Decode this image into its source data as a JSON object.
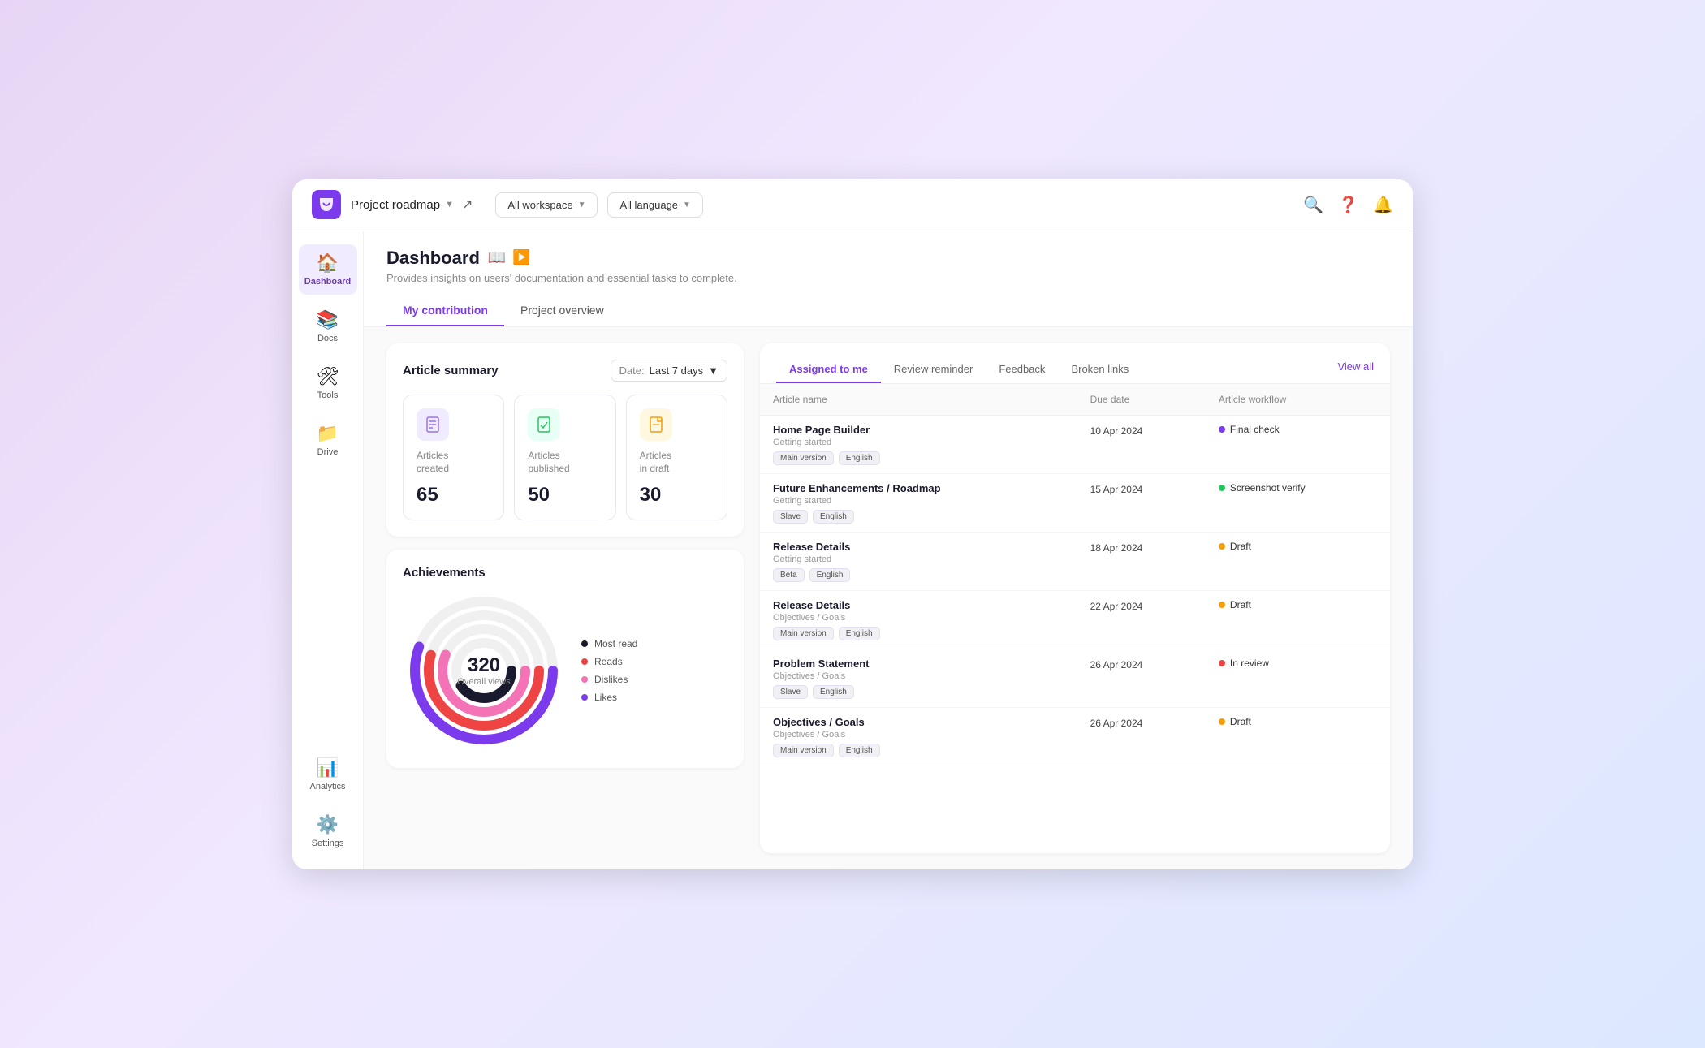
{
  "app": {
    "logo_alt": "Docsie logo",
    "project_name": "Project roadmap",
    "workspace_filter": "All workspace",
    "language_filter": "All language",
    "nav_icons": [
      "search",
      "help",
      "notifications"
    ]
  },
  "sidebar": {
    "items": [
      {
        "id": "dashboard",
        "label": "Dashboard",
        "icon": "🏠",
        "active": true
      },
      {
        "id": "docs",
        "label": "Docs",
        "icon": "📚",
        "active": false
      },
      {
        "id": "tools",
        "label": "Tools",
        "icon": "🛠",
        "active": false
      },
      {
        "id": "drive",
        "label": "Drive",
        "icon": "📁",
        "active": false
      },
      {
        "id": "analytics",
        "label": "Analytics",
        "icon": "📊",
        "active": false
      },
      {
        "id": "settings",
        "label": "Settings",
        "icon": "⚙️",
        "active": false
      }
    ]
  },
  "page": {
    "title": "Dashboard",
    "subtitle": "Provides insights on users' documentation and essential tasks to complete.",
    "tabs": [
      {
        "id": "my-contribution",
        "label": "My contribution",
        "active": true
      },
      {
        "id": "project-overview",
        "label": "Project overview",
        "active": false
      }
    ]
  },
  "article_summary": {
    "title": "Article summary",
    "date_label": "Date:",
    "date_value": "Last 7 days",
    "stats": [
      {
        "id": "created",
        "label": "Articles\ncreated",
        "value": "65",
        "icon": "📄",
        "color": "purple"
      },
      {
        "id": "published",
        "label": "Articles\npublished",
        "value": "50",
        "icon": "📋",
        "color": "green"
      },
      {
        "id": "draft",
        "label": "Articles\nin draft",
        "value": "30",
        "icon": "✏️",
        "color": "yellow"
      }
    ]
  },
  "achievements": {
    "title": "Achievements",
    "total_views": "320",
    "total_label": "Overall views",
    "legend": [
      {
        "id": "most-read",
        "label": "Most read",
        "color": "#1a1a2e"
      },
      {
        "id": "reads",
        "label": "Reads",
        "color": "#ef4444"
      },
      {
        "id": "dislikes",
        "label": "Dislikes",
        "color": "#f472b6"
      },
      {
        "id": "likes",
        "label": "Likes",
        "color": "#7c3aed"
      }
    ],
    "chart": {
      "rings": [
        {
          "color": "#7c3aed",
          "radius": 85,
          "stroke": 12,
          "dasharray": "400 135",
          "rotation": -90
        },
        {
          "color": "#ef4444",
          "radius": 68,
          "stroke": 12,
          "dasharray": "320 107",
          "rotation": -90
        },
        {
          "color": "#f472b6",
          "radius": 51,
          "stroke": 12,
          "dasharray": "260 80",
          "rotation": -90
        },
        {
          "color": "#1a1a2e",
          "radius": 34,
          "stroke": 12,
          "dasharray": "200 14",
          "rotation": -90
        }
      ]
    }
  },
  "panel": {
    "tabs": [
      {
        "id": "assigned-to-me",
        "label": "Assigned to me",
        "active": true
      },
      {
        "id": "review-reminder",
        "label": "Review reminder",
        "active": false
      },
      {
        "id": "feedback",
        "label": "Feedback",
        "active": false
      },
      {
        "id": "broken-links",
        "label": "Broken links",
        "active": false
      }
    ],
    "view_all": "View all",
    "columns": [
      {
        "id": "article-name",
        "label": "Article name"
      },
      {
        "id": "due-date",
        "label": "Due date"
      },
      {
        "id": "article-workflow",
        "label": "Article workflow"
      }
    ],
    "rows": [
      {
        "name": "Home Page Builder",
        "category": "Getting started",
        "tags": [
          "Main version",
          "English"
        ],
        "due_date": "10 Apr 2024",
        "workflow": "Final check",
        "workflow_color": "dot-purple"
      },
      {
        "name": "Future Enhancements / Roadmap",
        "category": "Getting started",
        "tags": [
          "Slave",
          "English"
        ],
        "due_date": "15 Apr 2024",
        "workflow": "Screenshot verify",
        "workflow_color": "dot-green"
      },
      {
        "name": "Release Details",
        "category": "Getting started",
        "tags": [
          "Beta",
          "English"
        ],
        "due_date": "18 Apr 2024",
        "workflow": "Draft",
        "workflow_color": "dot-orange"
      },
      {
        "name": "Release Details",
        "category": "Objectives / Goals",
        "tags": [
          "Main version",
          "English"
        ],
        "due_date": "22 Apr 2024",
        "workflow": "Draft",
        "workflow_color": "dot-orange"
      },
      {
        "name": "Problem Statement",
        "category": "Objectives / Goals",
        "tags": [
          "Slave",
          "English"
        ],
        "due_date": "26 Apr 2024",
        "workflow": "In review",
        "workflow_color": "dot-red"
      },
      {
        "name": "Objectives / Goals",
        "category": "Objectives / Goals",
        "tags": [
          "Main version",
          "English"
        ],
        "due_date": "26 Apr 2024",
        "workflow": "Draft",
        "workflow_color": "dot-orange"
      }
    ]
  }
}
